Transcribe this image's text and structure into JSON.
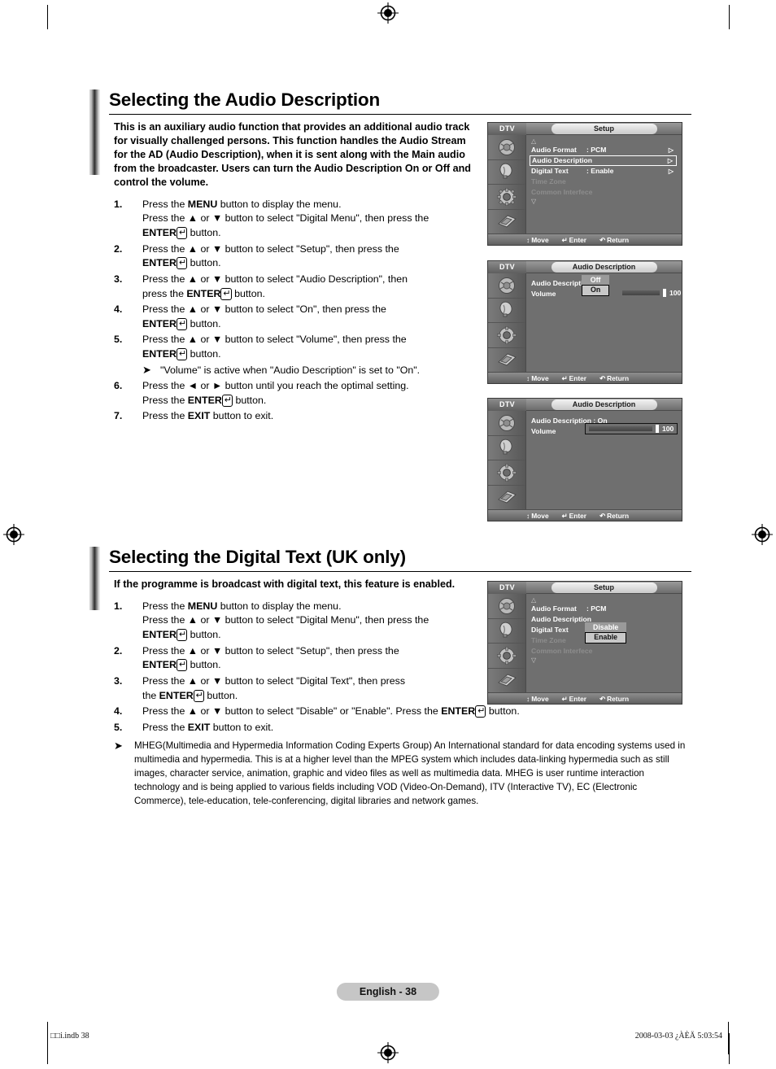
{
  "sections": [
    {
      "title": "Selecting the Audio Description",
      "intro": "This is an auxiliary audio function that provides an additional audio track for visually challenged persons. This function handles the Audio Stream for the AD (Audio Description), when it is sent along with the Main audio from the broadcaster. Users can turn the Audio Description On or Off and control the volume.",
      "steps": [
        {
          "num": "1.",
          "lines": [
            {
              "parts": [
                {
                  "t": "Press the "
                },
                {
                  "t": "MENU",
                  "b": true
                },
                {
                  "t": " button to display the menu."
                }
              ]
            },
            {
              "parts": [
                {
                  "t": "Press the ▲ or ▼ button to select \"Digital Menu\", then press the"
                }
              ]
            },
            {
              "parts": [
                {
                  "t": "ENTER",
                  "b": true
                },
                {
                  "t": "↵",
                  "enter": true
                },
                {
                  "t": " button."
                }
              ]
            }
          ]
        },
        {
          "num": "2.",
          "lines": [
            {
              "parts": [
                {
                  "t": "Press the ▲ or ▼ button to select \"Setup\", then press the"
                }
              ]
            },
            {
              "parts": [
                {
                  "t": "ENTER",
                  "b": true
                },
                {
                  "t": "↵",
                  "enter": true
                },
                {
                  "t": " button."
                }
              ]
            }
          ]
        },
        {
          "num": "3.",
          "lines": [
            {
              "parts": [
                {
                  "t": "Press the ▲ or ▼ button to select \"Audio Description\", then"
                }
              ]
            },
            {
              "parts": [
                {
                  "t": "press the "
                },
                {
                  "t": "ENTER",
                  "b": true
                },
                {
                  "t": "↵",
                  "enter": true
                },
                {
                  "t": " button."
                }
              ]
            }
          ]
        },
        {
          "num": "4.",
          "lines": [
            {
              "parts": [
                {
                  "t": "Press the ▲ or ▼ button to select \"On\", then press the"
                }
              ]
            },
            {
              "parts": [
                {
                  "t": "ENTER",
                  "b": true
                },
                {
                  "t": "↵",
                  "enter": true
                },
                {
                  "t": " button."
                }
              ]
            }
          ]
        },
        {
          "num": "5.",
          "lines": [
            {
              "parts": [
                {
                  "t": "Press the ▲ or ▼ button to select \"Volume\", then press the"
                }
              ]
            },
            {
              "parts": [
                {
                  "t": "ENTER",
                  "b": true
                },
                {
                  "t": "↵",
                  "enter": true
                },
                {
                  "t": " button."
                }
              ]
            }
          ],
          "note": "\"Volume\" is active when \"Audio Description\" is set to \"On\"."
        },
        {
          "num": "6.",
          "lines": [
            {
              "parts": [
                {
                  "t": "Press the ◄ or ► button until you reach the optimal setting."
                }
              ]
            },
            {
              "parts": [
                {
                  "t": "Press the "
                },
                {
                  "t": "ENTER",
                  "b": true
                },
                {
                  "t": "↵",
                  "enter": true
                },
                {
                  "t": " button."
                }
              ]
            }
          ]
        },
        {
          "num": "7.",
          "lines": [
            {
              "parts": [
                {
                  "t": "Press the "
                },
                {
                  "t": "EXIT",
                  "b": true
                },
                {
                  "t": " button to exit."
                }
              ]
            }
          ]
        }
      ]
    },
    {
      "title": "Selecting the Digital Text (UK only)",
      "intro": "If the programme is broadcast with digital text, this feature is enabled.",
      "steps": [
        {
          "num": "1.",
          "lines": [
            {
              "parts": [
                {
                  "t": "Press the "
                },
                {
                  "t": "MENU",
                  "b": true
                },
                {
                  "t": " button to display the menu."
                }
              ]
            },
            {
              "parts": [
                {
                  "t": "Press the ▲ or ▼ button to select \"Digital Menu\", then press the"
                }
              ]
            },
            {
              "parts": [
                {
                  "t": "ENTER",
                  "b": true
                },
                {
                  "t": "↵",
                  "enter": true
                },
                {
                  "t": " button."
                }
              ]
            }
          ]
        },
        {
          "num": "2.",
          "lines": [
            {
              "parts": [
                {
                  "t": "Press the ▲ or ▼ button to select \"Setup\", then press the"
                }
              ]
            },
            {
              "parts": [
                {
                  "t": "ENTER",
                  "b": true
                },
                {
                  "t": "↵",
                  "enter": true
                },
                {
                  "t": " button."
                }
              ]
            }
          ]
        },
        {
          "num": "3.",
          "lines": [
            {
              "parts": [
                {
                  "t": "Press the ▲ or ▼ button to select \"Digital Text\", then press"
                }
              ]
            },
            {
              "parts": [
                {
                  "t": "the "
                },
                {
                  "t": "ENTER",
                  "b": true
                },
                {
                  "t": "↵",
                  "enter": true
                },
                {
                  "t": " button."
                }
              ]
            }
          ]
        },
        {
          "num": "4.",
          "lines": [
            {
              "parts": [
                {
                  "t": "Press the ▲ or ▼ button to select \"Disable\" or \"Enable\". Press the "
                },
                {
                  "t": "ENTER",
                  "b": true
                },
                {
                  "t": "↵",
                  "enter": true
                },
                {
                  "t": " button."
                }
              ]
            }
          ]
        },
        {
          "num": "5.",
          "lines": [
            {
              "parts": [
                {
                  "t": "Press the "
                },
                {
                  "t": "EXIT",
                  "b": true
                },
                {
                  "t": " button to exit."
                }
              ]
            }
          ]
        }
      ],
      "tail_note": "MHEG(Multimedia and Hypermedia Information Coding Experts Group) An International standard for data encoding systems used in multimedia and hypermedia. This is at a higher level than the MPEG system which includes data-linking hypermedia such as still images, character service, animation, graphic and video files as well as multimedia data. MHEG is user runtime interaction technology and is being applied to various fields including VOD (Video-On-Demand), ITV (Interactive TV), EC (Electronic Commerce), tele-education, tele-conferencing, digital libraries and network games."
    }
  ],
  "osd_common": {
    "source": "DTV",
    "bottom": [
      {
        "icon": "↕",
        "label": "Move"
      },
      {
        "icon": "↵",
        "label": "Enter"
      },
      {
        "icon": "↶",
        "label": "Return"
      }
    ],
    "rail_icons": [
      "picture-icon",
      "sound-icon",
      "setup-gear-icon",
      "input-icon"
    ]
  },
  "osd_screens": [
    {
      "id": "setup-audio-description",
      "title": "Setup",
      "scroll_up": "△",
      "scroll_down": "▽",
      "rows": [
        {
          "label": "Audio Format",
          "value": ": PCM",
          "chevron": "▷",
          "state": "normal"
        },
        {
          "label": "Audio Description",
          "value": "",
          "chevron": "▷",
          "state": "selected"
        },
        {
          "label": "Digital Text",
          "value": ": Enable",
          "chevron": "▷",
          "state": "normal"
        },
        {
          "label": "Time Zone",
          "value": "",
          "chevron": "",
          "state": "dim"
        },
        {
          "label": "Common Interfece",
          "value": "",
          "chevron": "",
          "state": "dim"
        }
      ]
    },
    {
      "id": "audio-description-onoff",
      "title": "Audio Description",
      "rows": [
        {
          "label": "Audio Description",
          "value": ":",
          "state": "normal"
        },
        {
          "label": "Volume",
          "value": "",
          "state": "normal"
        }
      ],
      "popup": {
        "options": [
          "Off",
          "On"
        ],
        "active": "On"
      },
      "volume": {
        "value": "100",
        "percent": 100
      }
    },
    {
      "id": "audio-description-volume",
      "title": "Audio Description",
      "rows": [
        {
          "label": "Audio Description : On",
          "value": "",
          "state": "normal"
        },
        {
          "label": "Volume",
          "value": "",
          "state": "normal"
        }
      ],
      "volume": {
        "value": "100",
        "percent": 100,
        "boxed": true
      }
    },
    {
      "id": "setup-digital-text",
      "title": "Setup",
      "scroll_up": "△",
      "scroll_down": "▽",
      "rows": [
        {
          "label": "Audio Format",
          "value": ": PCM",
          "state": "normal"
        },
        {
          "label": "Audio Description",
          "value": "",
          "state": "normal"
        },
        {
          "label": "Digital Text",
          "value": ":",
          "state": "normal"
        },
        {
          "label": "Time Zone",
          "value": "",
          "state": "dim"
        },
        {
          "label": "Common Interfece",
          "value": "",
          "state": "dim"
        }
      ],
      "popup": {
        "options": [
          "Disable",
          "Enable"
        ],
        "active": "Enable"
      }
    }
  ],
  "footer": {
    "page_label": "English - 38",
    "print_left": "□□i.indb  38",
    "print_right": "2008-03-03  ¿ÀÈÄ 5:03:54"
  },
  "colors": {
    "osd_bg": "#6f6f6f",
    "osd_rail": "#5d5d5d",
    "page_label_bg": "#c6c6c6",
    "accent_rule": "#000000"
  }
}
